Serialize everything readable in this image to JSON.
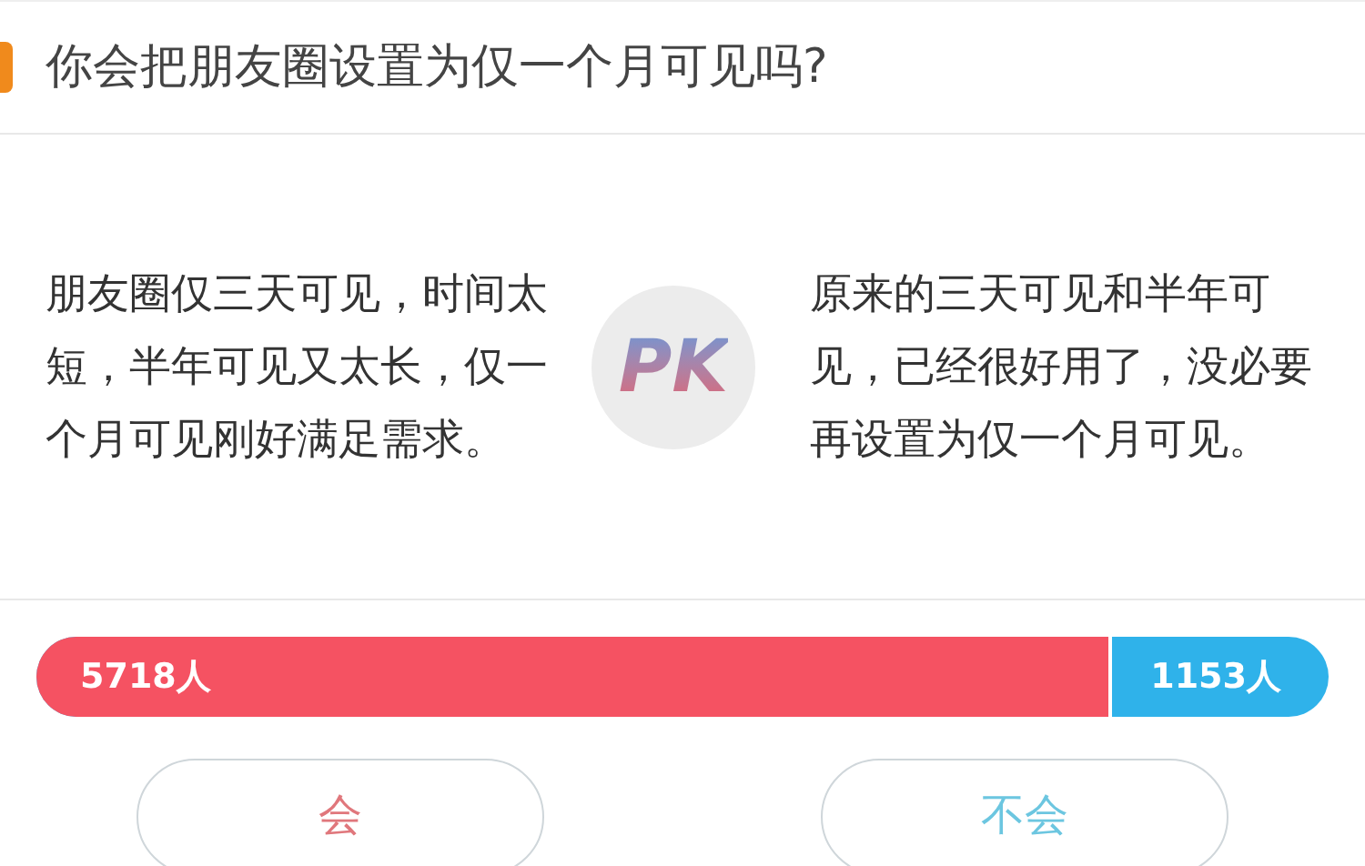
{
  "question": "你会把朋友圈设置为仅一个月可见吗?",
  "sides": [
    {
      "text": "朋友圈仅三天可见，时间太短，半年可见又太长，仅一个月可见刚好满足需求。"
    },
    {
      "text": "原来的三天可见和半年可见，已经很好用了，没必要再设置为仅一个月可见。"
    }
  ],
  "versus": "PK",
  "result": {
    "level": 0.832,
    "left_count": "5718人",
    "right_count": "1153人"
  },
  "buttons": [
    {
      "label": "会",
      "kind": "yes"
    },
    {
      "label": "不会",
      "kind": "no"
    }
  ]
}
